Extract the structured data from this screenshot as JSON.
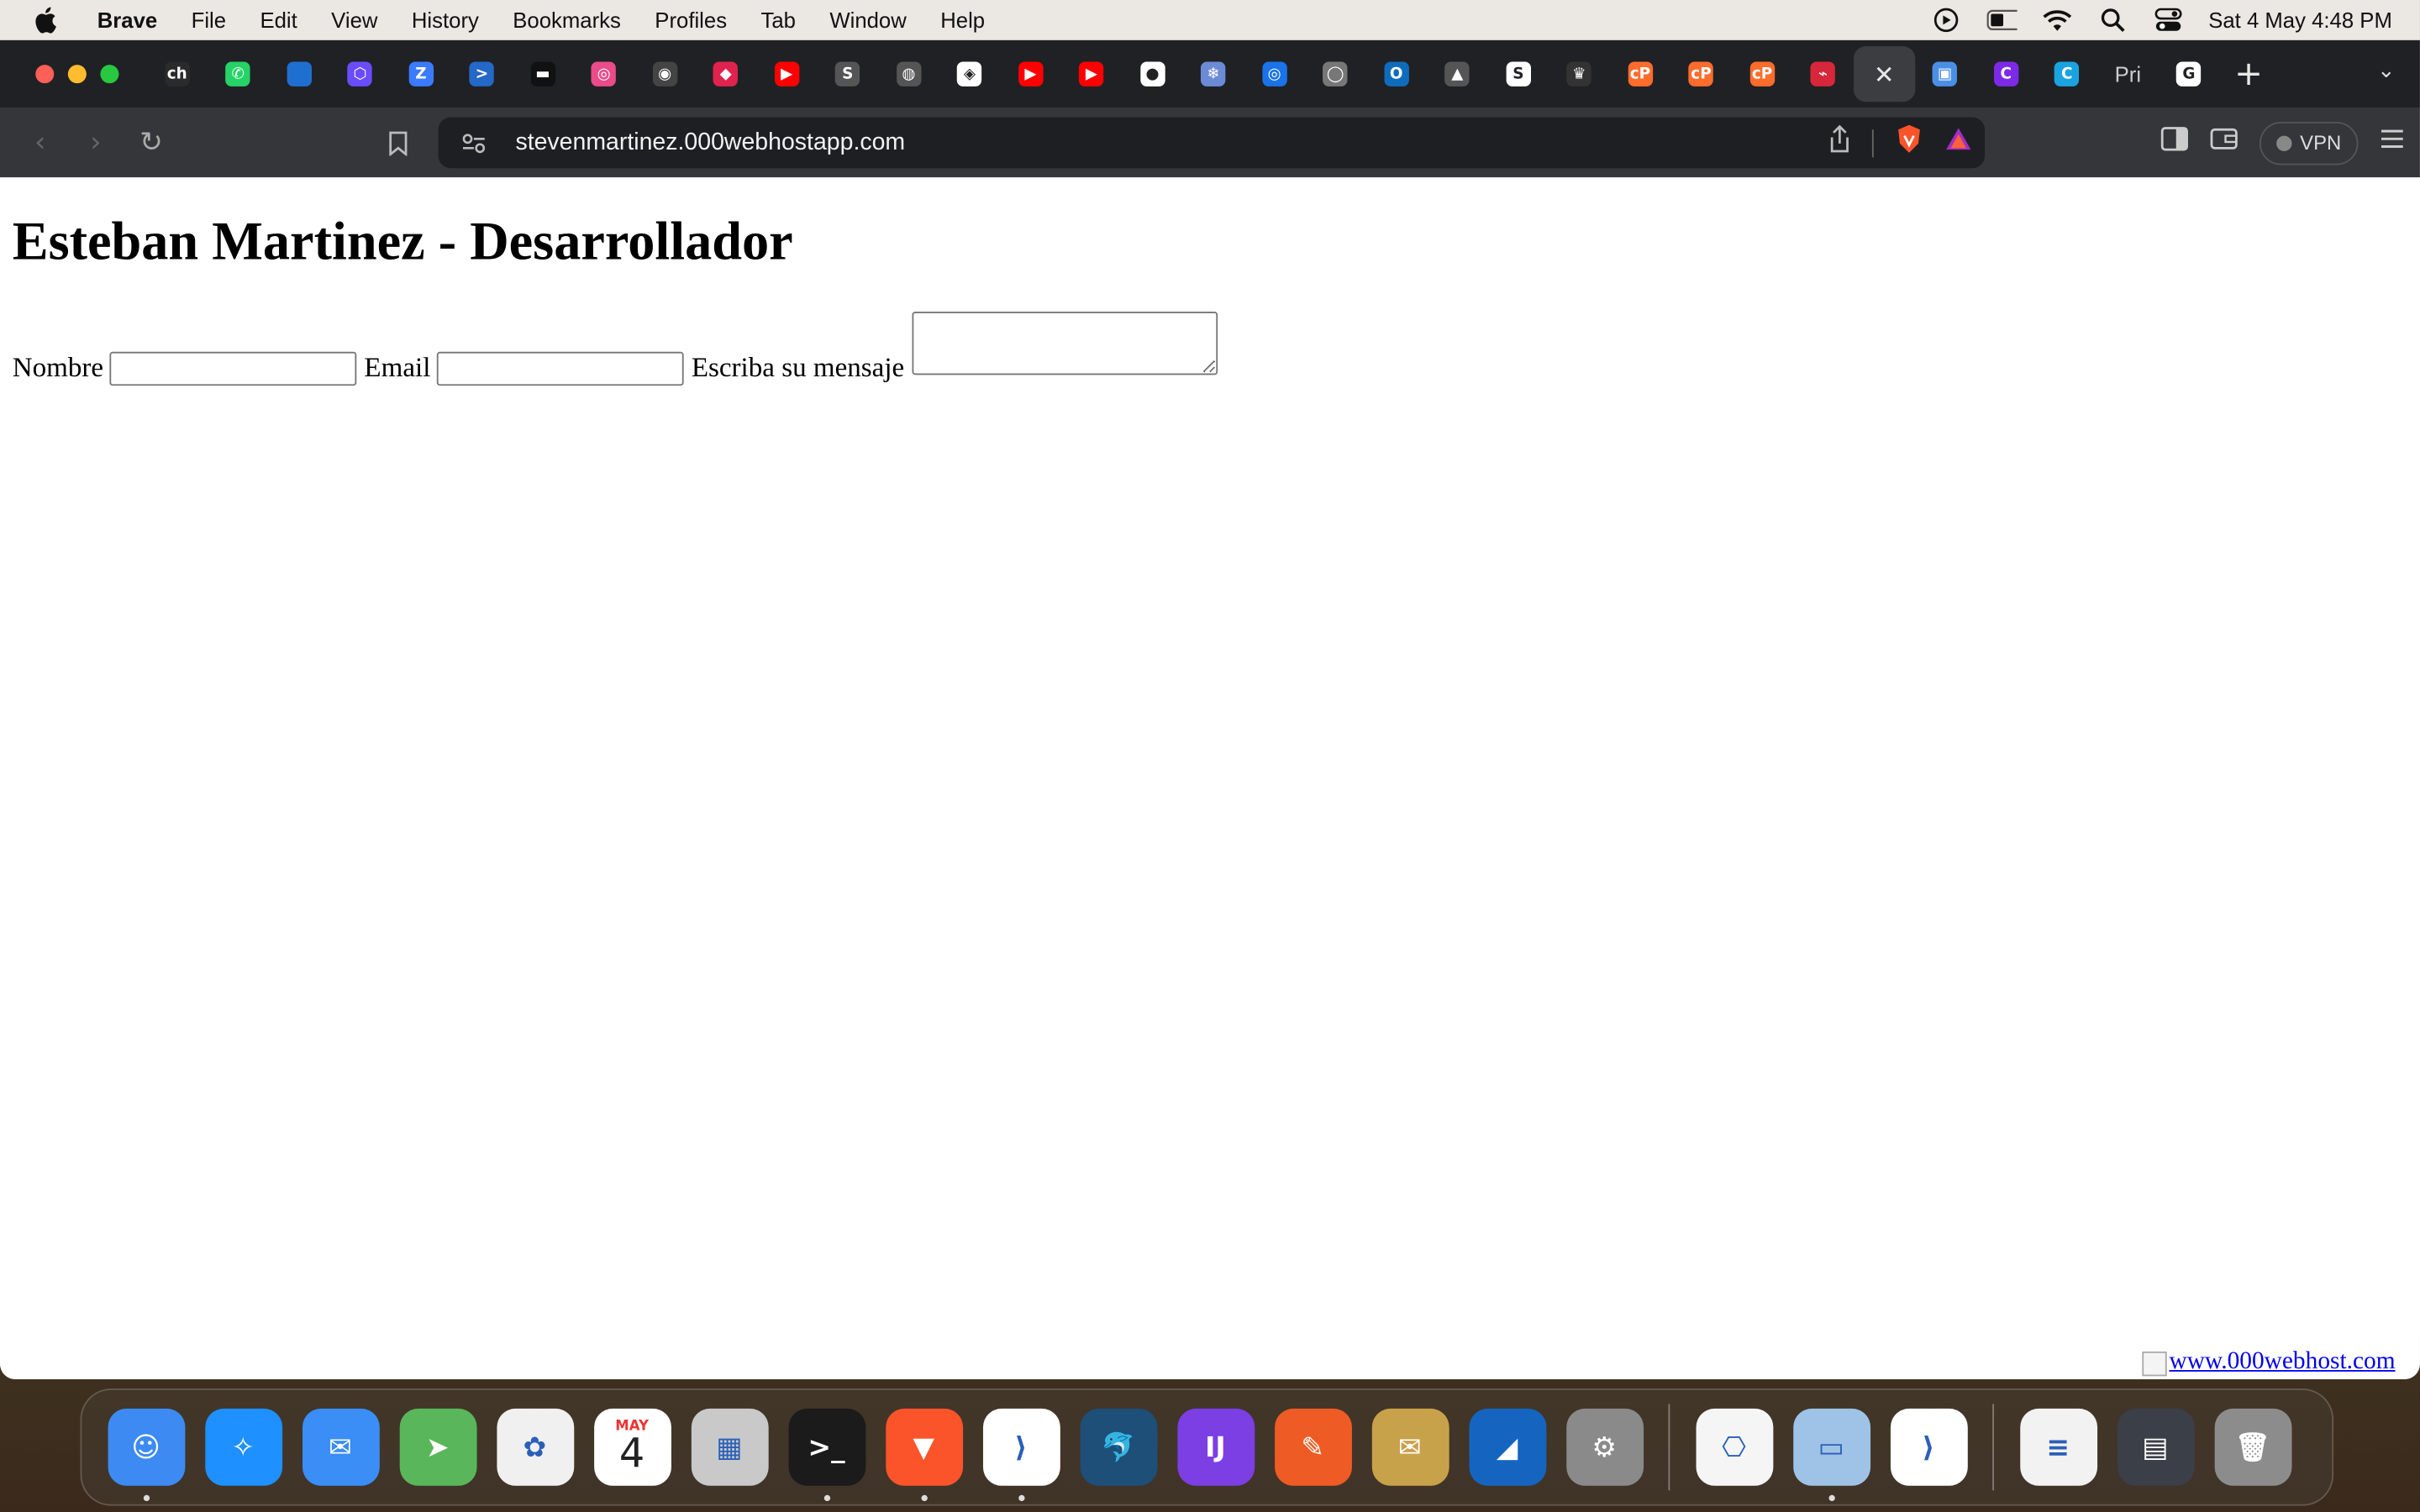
{
  "menubar": {
    "app_name": "Brave",
    "items": [
      "File",
      "Edit",
      "View",
      "History",
      "Bookmarks",
      "Profiles",
      "Tab",
      "Window",
      "Help"
    ],
    "datetime": "Sat 4 May  4:48 PM"
  },
  "tabs": [
    {
      "icon": "ch-icon",
      "color": "#2b2b2b",
      "glyph": "ch"
    },
    {
      "icon": "whatsapp-icon",
      "color": "#25d366",
      "glyph": "✆"
    },
    {
      "icon": "globe-icon",
      "color": "#1f6fd1",
      "glyph": ""
    },
    {
      "icon": "hexagon-icon",
      "color": "#6a4cff",
      "glyph": "⬡"
    },
    {
      "icon": "zoho-icon",
      "color": "#3b7bff",
      "glyph": "Z"
    },
    {
      "icon": "powershell-icon",
      "color": "#2468c8",
      "glyph": ">"
    },
    {
      "icon": "unsplash-icon",
      "color": "#111111",
      "glyph": "▬"
    },
    {
      "icon": "dribbble-icon",
      "color": "#ea4c89",
      "glyph": "◎"
    },
    {
      "icon": "record-icon",
      "color": "#444444",
      "glyph": "◉"
    },
    {
      "icon": "nestjs-icon",
      "color": "#e0234e",
      "glyph": "◆"
    },
    {
      "icon": "youtube-icon",
      "color": "#ff0000",
      "glyph": "▶"
    },
    {
      "icon": "s-circle-icon",
      "color": "#555555",
      "glyph": "S"
    },
    {
      "icon": "brand-circle-icon",
      "color": "#555555",
      "glyph": "◍"
    },
    {
      "icon": "codepen-icon",
      "color": "#ffffff",
      "glyph": "◈"
    },
    {
      "icon": "youtube-icon",
      "color": "#ff0000",
      "glyph": "▶"
    },
    {
      "icon": "youtube-icon",
      "color": "#ff0000",
      "glyph": "▶"
    },
    {
      "icon": "github-icon",
      "color": "#ffffff",
      "glyph": "●"
    },
    {
      "icon": "snowflake-icon",
      "color": "#6b8bd6",
      "glyph": "❄"
    },
    {
      "icon": "target-icon",
      "color": "#1a73e8",
      "glyph": "◎"
    },
    {
      "icon": "github-alt-icon",
      "color": "#777777",
      "glyph": "◯"
    },
    {
      "icon": "outlook-icon",
      "color": "#0f6cbd",
      "glyph": "O"
    },
    {
      "icon": "drive-icon",
      "color": "#555555",
      "glyph": "▲"
    },
    {
      "icon": "skype-icon",
      "color": "#ffffff",
      "glyph": "S"
    },
    {
      "icon": "trophy-icon",
      "color": "#333333",
      "glyph": "♛"
    },
    {
      "icon": "cpanel-icon",
      "color": "#ff6c2c",
      "glyph": "cP"
    },
    {
      "icon": "cpanel-icon",
      "color": "#ff6c2c",
      "glyph": "cP"
    },
    {
      "icon": "cpanel-icon",
      "color": "#ff6c2c",
      "glyph": "cP"
    },
    {
      "icon": "swirl-icon",
      "color": "#d8263b",
      "glyph": "⌁"
    },
    {
      "icon": "close-icon",
      "color": "",
      "glyph": "",
      "active": true
    },
    {
      "icon": "store-icon",
      "color": "#4a8fe7",
      "glyph": "▣"
    },
    {
      "icon": "canva-icon",
      "color": "#7d2ae8",
      "glyph": "C"
    },
    {
      "icon": "canva-icon",
      "color": "#1aa3e0",
      "glyph": "C"
    },
    {
      "icon": "text-tab-icon",
      "color": "",
      "glyph": "",
      "text": "Pri"
    },
    {
      "icon": "google-icon",
      "color": "#ffffff",
      "glyph": "G"
    }
  ],
  "toolbar": {
    "url": "stevenmartinez.000webhostapp.com",
    "vpn_label": "VPN"
  },
  "page": {
    "heading": "Esteban Martinez - Desarrollador",
    "name_label": "Nombre",
    "email_label": "Email",
    "message_label": "Escriba su mensaje",
    "name_value": "",
    "email_value": "",
    "message_value": "",
    "host_link": "www.000webhost.com"
  },
  "dock": {
    "calendar_month": "MAY",
    "calendar_day": "4",
    "apps": [
      {
        "name": "finder-icon",
        "color": "#3d8bf2",
        "glyph": "☺",
        "running": true
      },
      {
        "name": "safari-icon",
        "color": "#1e90ff",
        "glyph": "✧",
        "running": false
      },
      {
        "name": "mail-icon",
        "color": "#3a8ef6",
        "glyph": "✉",
        "running": false
      },
      {
        "name": "maps-icon",
        "color": "#5ab65a",
        "glyph": "➤",
        "running": false
      },
      {
        "name": "photos-icon",
        "color": "#f0f0f0",
        "glyph": "✿",
        "running": false
      },
      {
        "name": "calendar-icon",
        "color": "#ffffff",
        "glyph": "",
        "running": false,
        "calendar": true
      },
      {
        "name": "launchpad-icon",
        "color": "#c9c9c9",
        "glyph": "▦",
        "running": false
      },
      {
        "name": "terminal-icon",
        "color": "#1b1b1b",
        "glyph": ">_",
        "running": true
      },
      {
        "name": "brave-icon",
        "color": "#fb542b",
        "glyph": "▼",
        "running": true
      },
      {
        "name": "vscode-icon",
        "color": "#ffffff",
        "glyph": "⟩",
        "running": true
      },
      {
        "name": "mysql-workbench-icon",
        "color": "#1d4f79",
        "glyph": "🐬",
        "running": false
      },
      {
        "name": "intellij-icon",
        "color": "#7b3fe4",
        "glyph": "IJ",
        "running": false
      },
      {
        "name": "postman-icon",
        "color": "#ef5b25",
        "glyph": "✎",
        "running": false
      },
      {
        "name": "mail-search-icon",
        "color": "#c8a24a",
        "glyph": "✉",
        "running": false
      },
      {
        "name": "wireshark-icon",
        "color": "#1565c0",
        "glyph": "◢",
        "running": false
      },
      {
        "name": "system-settings-icon",
        "color": "#8a8a8a",
        "glyph": "⚙",
        "running": false
      }
    ],
    "apps2": [
      {
        "name": "system-information-icon",
        "color": "#f5f5f5",
        "glyph": "⎔",
        "running": false
      },
      {
        "name": "preview-icon",
        "color": "#9ec3e6",
        "glyph": "▭",
        "running": true
      },
      {
        "name": "vscode-icon",
        "color": "#ffffff",
        "glyph": "⟩",
        "running": false
      }
    ],
    "apps3": [
      {
        "name": "document-icon",
        "color": "#f2f2f2",
        "glyph": "≡",
        "running": false
      },
      {
        "name": "screenshots-folder-icon",
        "color": "#3a3f48",
        "glyph": "▤",
        "running": false
      },
      {
        "name": "trash-icon",
        "color": "#8c8c8c",
        "glyph": "🗑",
        "running": false
      }
    ]
  }
}
